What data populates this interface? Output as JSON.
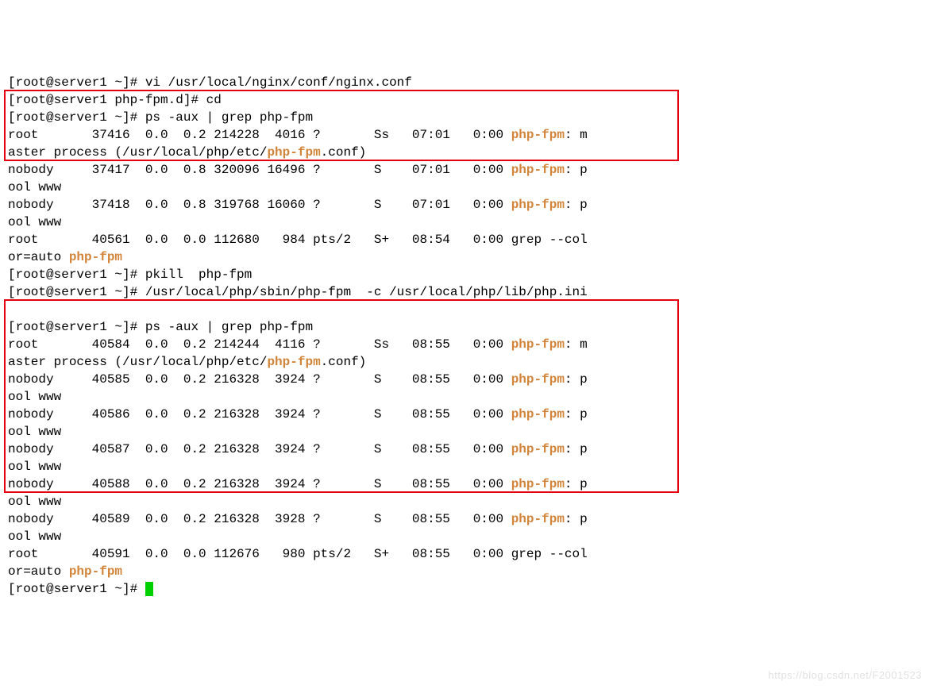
{
  "prompts": {
    "p1": {
      "user": "root",
      "host": "server1",
      "cwd": "~",
      "cmd": "vi /usr/local/nginx/conf/nginx.conf"
    },
    "p2": {
      "user": "root",
      "host": "server1",
      "cwd": "php-fpm.d",
      "cmd": "cd"
    },
    "p3": {
      "user": "root",
      "host": "server1",
      "cwd": "~",
      "cmd": "ps -aux | grep php-fpm"
    },
    "p4": {
      "user": "root",
      "host": "server1",
      "cwd": "~",
      "cmd": "pkill  php-fpm"
    },
    "p5": {
      "user": "root",
      "host": "server1",
      "cwd": "~",
      "cmd": "/usr/local/php/sbin/php-fpm  -c /usr/local/php/lib/php.ini"
    },
    "p6": {
      "user": "root",
      "host": "server1",
      "cwd": "~",
      "cmd": "ps -aux | grep php-fpm"
    },
    "p7": {
      "user": "root",
      "host": "server1",
      "cwd": "~",
      "cmd": ""
    }
  },
  "ps1": {
    "master": {
      "user": "root",
      "pid": "37416",
      "cpu": "0.0",
      "mem": "0.2",
      "vsz": "214228",
      "rss": "4016",
      "tty": "?",
      "stat": "Ss",
      "start": "07:01",
      "time": "0:00",
      "proc": "php-fpm",
      "tail": ": m",
      "wrap_a": "aster process (/usr/local/php/etc/",
      "wrap_hl": "php-fpm",
      "wrap_b": ".conf)"
    },
    "workers": [
      {
        "user": "nobody",
        "pid": "37417",
        "cpu": "0.0",
        "mem": "0.8",
        "vsz": "320096",
        "rss": "16496",
        "tty": "?",
        "stat": "S",
        "start": "07:01",
        "time": "0:00",
        "proc": "php-fpm",
        "tail": ": p",
        "wrap": "ool www"
      },
      {
        "user": "nobody",
        "pid": "37418",
        "cpu": "0.0",
        "mem": "0.8",
        "vsz": "319768",
        "rss": "16060",
        "tty": "?",
        "stat": "S",
        "start": "07:01",
        "time": "0:00",
        "proc": "php-fpm",
        "tail": ": p",
        "wrap": "ool www"
      }
    ],
    "grep": {
      "user": "root",
      "pid": "40561",
      "cpu": "0.0",
      "mem": "0.0",
      "vsz": "112680",
      "rss": "984",
      "tty": "pts/2",
      "stat": "S+",
      "start": "08:54",
      "time": "0:00",
      "proc_a": "grep --col",
      "wrap_a": "or=auto ",
      "wrap_hl": "php-fpm"
    }
  },
  "ps2": {
    "master": {
      "user": "root",
      "pid": "40584",
      "cpu": "0.0",
      "mem": "0.2",
      "vsz": "214244",
      "rss": "4116",
      "tty": "?",
      "stat": "Ss",
      "start": "08:55",
      "time": "0:00",
      "proc": "php-fpm",
      "tail": ": m",
      "wrap_a": "aster process (/usr/local/php/etc/",
      "wrap_hl": "php-fpm",
      "wrap_b": ".conf)"
    },
    "workers": [
      {
        "user": "nobody",
        "pid": "40585",
        "cpu": "0.0",
        "mem": "0.2",
        "vsz": "216328",
        "rss": "3924",
        "tty": "?",
        "stat": "S",
        "start": "08:55",
        "time": "0:00",
        "proc": "php-fpm",
        "tail": ": p",
        "wrap": "ool www"
      },
      {
        "user": "nobody",
        "pid": "40586",
        "cpu": "0.0",
        "mem": "0.2",
        "vsz": "216328",
        "rss": "3924",
        "tty": "?",
        "stat": "S",
        "start": "08:55",
        "time": "0:00",
        "proc": "php-fpm",
        "tail": ": p",
        "wrap": "ool www"
      },
      {
        "user": "nobody",
        "pid": "40587",
        "cpu": "0.0",
        "mem": "0.2",
        "vsz": "216328",
        "rss": "3924",
        "tty": "?",
        "stat": "S",
        "start": "08:55",
        "time": "0:00",
        "proc": "php-fpm",
        "tail": ": p",
        "wrap": "ool www"
      },
      {
        "user": "nobody",
        "pid": "40588",
        "cpu": "0.0",
        "mem": "0.2",
        "vsz": "216328",
        "rss": "3924",
        "tty": "?",
        "stat": "S",
        "start": "08:55",
        "time": "0:00",
        "proc": "php-fpm",
        "tail": ": p",
        "wrap": "ool www"
      },
      {
        "user": "nobody",
        "pid": "40589",
        "cpu": "0.0",
        "mem": "0.2",
        "vsz": "216328",
        "rss": "3928",
        "tty": "?",
        "stat": "S",
        "start": "08:55",
        "time": "0:00",
        "proc": "php-fpm",
        "tail": ": p",
        "wrap": "ool www"
      }
    ],
    "grep": {
      "user": "root",
      "pid": "40591",
      "cpu": "0.0",
      "mem": "0.0",
      "vsz": "112676",
      "rss": "980",
      "tty": "pts/2",
      "stat": "S+",
      "start": "08:55",
      "time": "0:00",
      "proc_a": "grep --col",
      "wrap_a": "or=auto ",
      "wrap_hl": "php-fpm"
    }
  },
  "watermark": "https://blog.csdn.net/F2001523"
}
